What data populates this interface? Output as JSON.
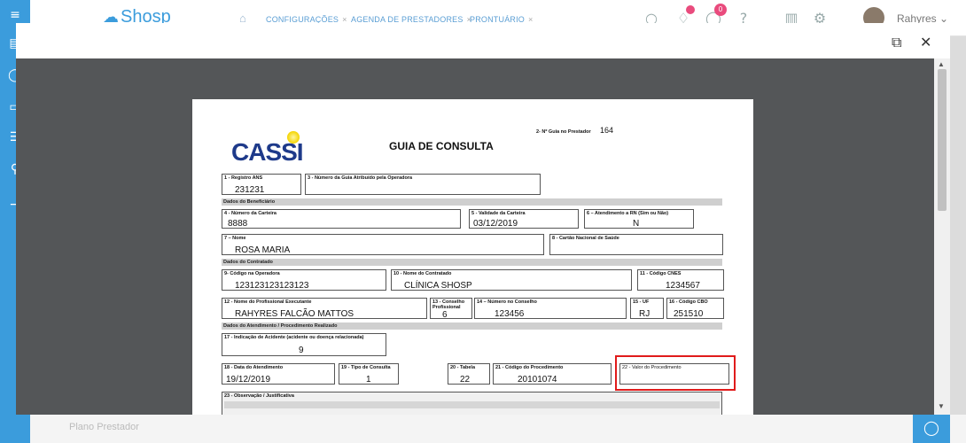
{
  "app": {
    "logo_text": "Shosp"
  },
  "breadcrumb": [
    {
      "label": "CONFIGURAÇÕES"
    },
    {
      "label": "AGENDA DE PRESTADORES"
    },
    {
      "label": "PRONTUÁRIO"
    }
  ],
  "header": {
    "notifications_badge": "0",
    "user_name": "Rahyres"
  },
  "background": {
    "bottom_text": "Plano Prestador"
  },
  "document": {
    "brand": "CASSI",
    "title": "GUIA DE CONSULTA",
    "guia_prestador_label": "2- Nº Guia no Prestador",
    "guia_prestador_value": "164",
    "fields": {
      "registro_ans": {
        "label": "1 - Registro ANS",
        "value": "231231"
      },
      "numero_guia_operadora": {
        "label": "3 - Número da Guia Atribuído pela Operadora",
        "value": ""
      },
      "numero_carteira": {
        "label": "4 - Número da Carteira",
        "value": "8888"
      },
      "validade_carteira": {
        "label": "5 - Validade da Carteira",
        "value": "03/12/2019"
      },
      "atendimento_rn": {
        "label": "6 – Atendimento a RN (Sim ou Não)",
        "value": "N"
      },
      "nome": {
        "label": "7 – Nome",
        "value": "ROSA MARIA"
      },
      "cartao_nacional": {
        "label": "8 - Cartão Nacional de Saúde",
        "value": ""
      },
      "codigo_operadora": {
        "label": "9- Código na Operadora",
        "value": "123123123123123"
      },
      "nome_contratado": {
        "label": "10 - Nome do Contratado",
        "value": "CLÍNICA SHOSP"
      },
      "codigo_cnes": {
        "label": "11 - Código CNES",
        "value": "1234567"
      },
      "profissional_executante": {
        "label": "12 - Nome do Profissional Executante",
        "value": "RAHYRES FALCÃO MATTOS"
      },
      "conselho_profissional": {
        "label": "13 - Conselho Profissional",
        "value": "6"
      },
      "numero_conselho": {
        "label": "14 – Número no Conselho",
        "value": "123456"
      },
      "uf": {
        "label": "15 - UF",
        "value": "RJ"
      },
      "codigo_cbo": {
        "label": "16 - Código CBO",
        "value": "251510"
      },
      "indicacao_acidente": {
        "label": "17 - Indicação de Acidente (acidente ou doença relacionada)",
        "value": "9"
      },
      "data_atendimento": {
        "label": "18 - Data do Atendimento",
        "value": "19/12/2019"
      },
      "tipo_consulta": {
        "label": "19 - Tipo de Consulta",
        "value": "1"
      },
      "tabela": {
        "label": "20 - Tabela",
        "value": "22"
      },
      "codigo_procedimento": {
        "label": "21 - Código do Procedimento",
        "value": "20101074"
      },
      "valor_procedimento": {
        "label": "22 - Valor do Procedimento",
        "value": ""
      },
      "observacao": {
        "label": "23 - Observação / Justificativa",
        "value": ""
      }
    },
    "sections": {
      "beneficiario": "Dados do Beneficiário",
      "contratado": "Dados do Contratado",
      "atendimento": "Dados do Atendimento / Procedimento Realizado"
    }
  },
  "colors": {
    "accent": "#3b9cdc",
    "highlight": "#e01b1b",
    "modal_backdrop": "#545658"
  }
}
